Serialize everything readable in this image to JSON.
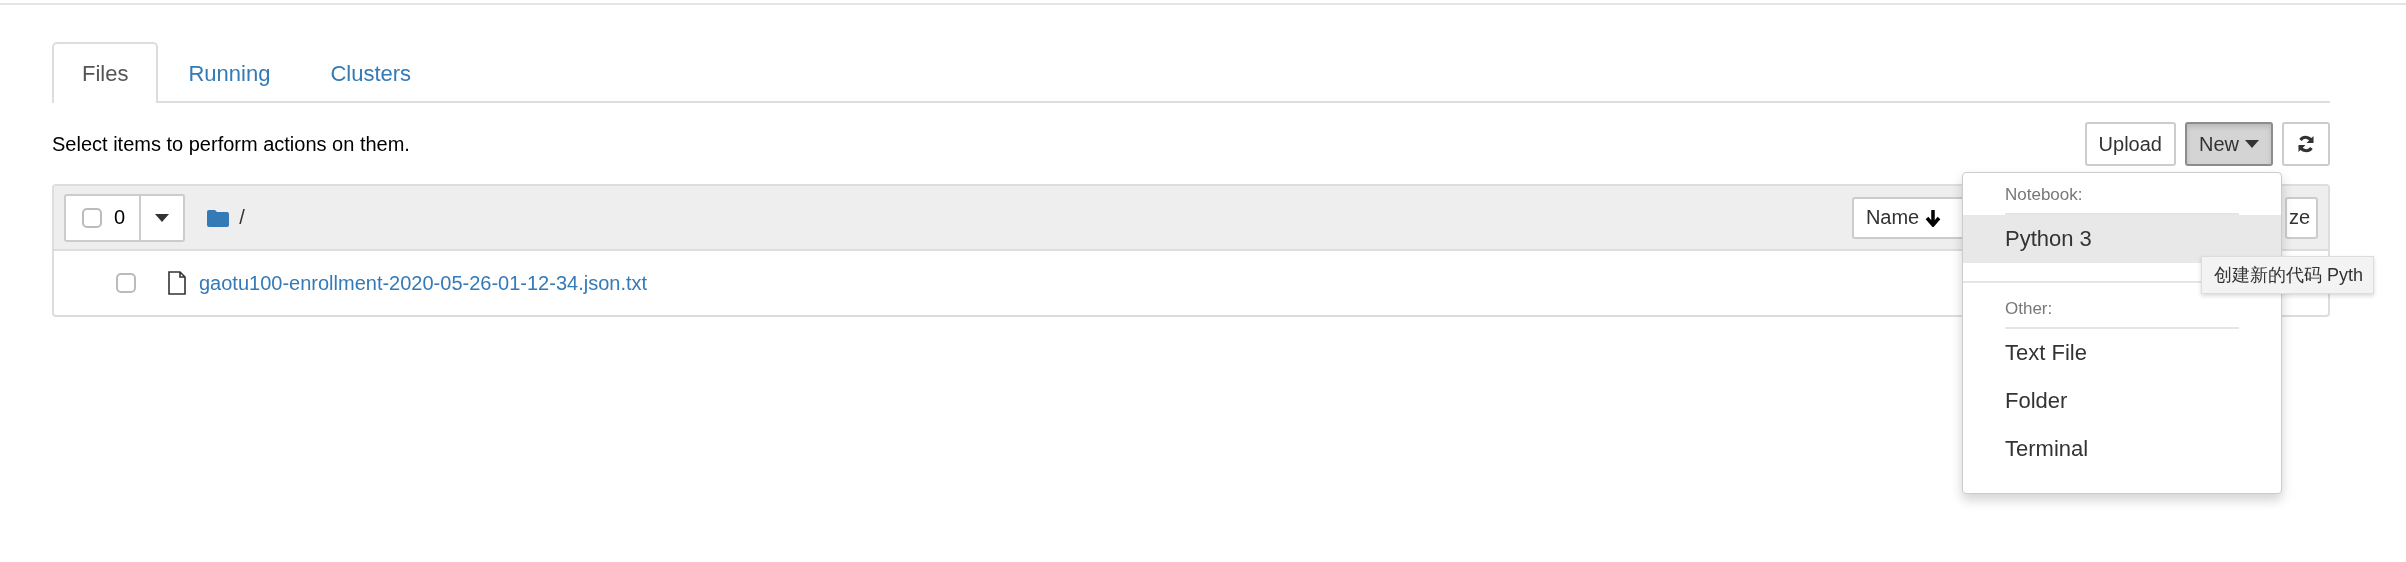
{
  "tabs": [
    {
      "label": "Files",
      "selected": true
    },
    {
      "label": "Running",
      "selected": false
    },
    {
      "label": "Clusters",
      "selected": false
    }
  ],
  "message": "Select items to perform actions on them.",
  "toolbar": {
    "upload": "Upload",
    "new": {
      "label": "New",
      "expanded": true
    }
  },
  "list_header": {
    "select_all": {
      "checked": false
    },
    "count": "0",
    "path": "/",
    "sort_buttons": [
      {
        "label": "Name",
        "sorted": true
      },
      {
        "label": "ze",
        "sorted": false
      }
    ]
  },
  "files": [
    {
      "name": "gaotu100-enrollment-2020-05-26-01-12-34.json.txt",
      "checked": false
    }
  ],
  "new_menu": {
    "sections": [
      {
        "header": "Notebook:",
        "items": [
          {
            "label": "Python 3",
            "selected": true
          }
        ]
      },
      {
        "header": "Other:",
        "items": [
          {
            "label": "Text File",
            "selected": false
          },
          {
            "label": "Folder",
            "selected": false
          },
          {
            "label": "Terminal",
            "selected": false
          }
        ]
      }
    ]
  },
  "tooltip": "创建新的代码 Pyth"
}
